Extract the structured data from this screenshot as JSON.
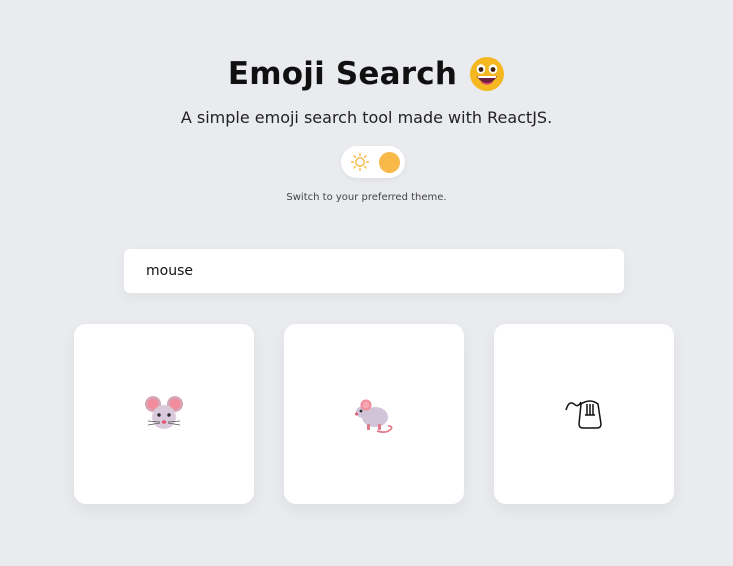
{
  "header": {
    "title": "Emoji Search",
    "title_emoji": "grinning-face-icon"
  },
  "subtitle": "A simple emoji search tool made with ReactJS.",
  "theme_toggle": {
    "state": "light",
    "icon": "sun-icon",
    "knob_color": "#f8b84a"
  },
  "hint": "Switch to your preferred theme.",
  "search": {
    "value": "mouse",
    "placeholder": ""
  },
  "results": [
    {
      "icon": "mouse-face-icon"
    },
    {
      "icon": "mouse-icon"
    },
    {
      "icon": "computer-mouse-icon"
    }
  ],
  "colors": {
    "background": "#e9ebee",
    "card": "#ffffff",
    "accent": "#f8b84a"
  }
}
